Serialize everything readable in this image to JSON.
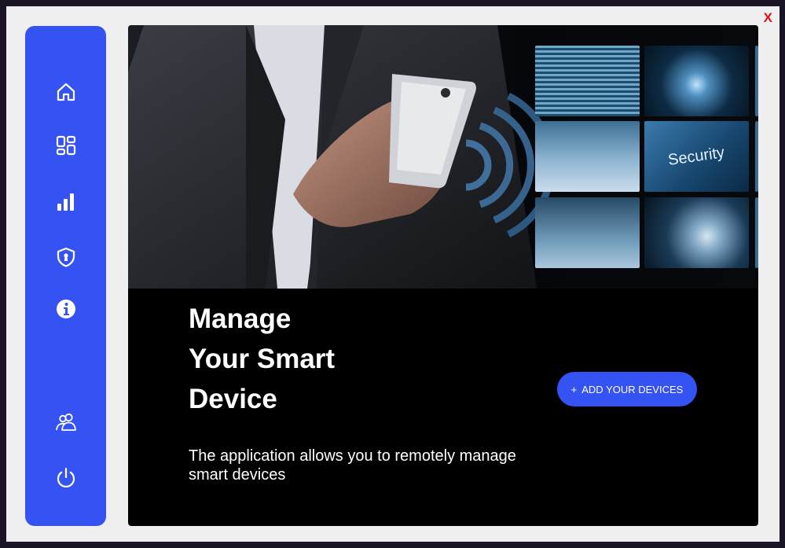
{
  "window": {
    "close_label": "X"
  },
  "sidebar": {
    "items": [
      {
        "name": "home",
        "icon": "home-icon"
      },
      {
        "name": "dashboard",
        "icon": "dashboard-grid-icon"
      },
      {
        "name": "statistics",
        "icon": "bar-chart-icon"
      },
      {
        "name": "security",
        "icon": "shield-keyhole-icon"
      },
      {
        "name": "info",
        "icon": "info-icon"
      },
      {
        "name": "users",
        "icon": "users-icon"
      },
      {
        "name": "power",
        "icon": "power-icon"
      }
    ]
  },
  "hero": {
    "headline_lines": [
      "Manage",
      "Your Smart",
      "Device"
    ],
    "description": "The application allows you to remotely manage smart devices",
    "image_caption": "Security",
    "add_button": {
      "icon": "+",
      "label": "ADD YOUR DEVICES"
    }
  },
  "colors": {
    "accent": "#3552f2",
    "panel_background": "#000000",
    "window_background": "#f0f0f0",
    "close_color": "#e31212"
  }
}
